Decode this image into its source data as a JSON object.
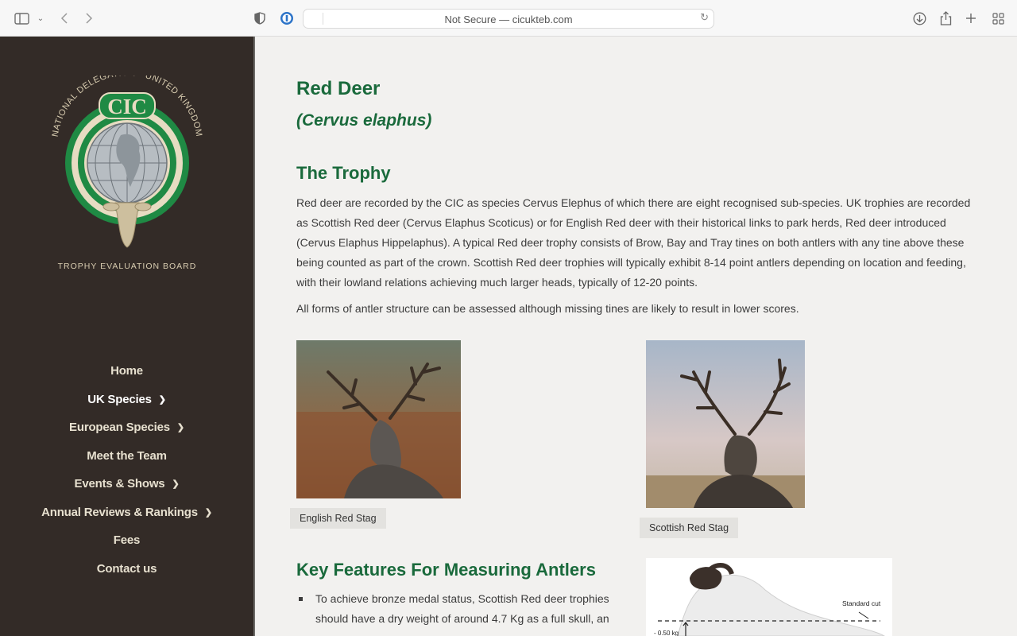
{
  "browser": {
    "address": "Not Secure — cicukteb.com",
    "icons": [
      "sidebar-icon",
      "chevron-down-icon",
      "back-icon",
      "forward-icon",
      "shield-icon",
      "password-icon",
      "reload-icon",
      "download-icon",
      "share-icon",
      "new-tab-icon",
      "tab-overview-icon"
    ]
  },
  "sidebar": {
    "logo_text_top": "NATIONAL DELEGATION · UNITED KINGDOM",
    "logo_text_cic": "CIC",
    "logo_text_bottom": "TROPHY EVALUATION BOARD",
    "nav": [
      {
        "label": "Home",
        "has_children": false
      },
      {
        "label": "UK Species",
        "has_children": true,
        "active": true
      },
      {
        "label": "European Species",
        "has_children": true
      },
      {
        "label": "Meet the Team",
        "has_children": false
      },
      {
        "label": "Events & Shows",
        "has_children": true
      },
      {
        "label": "Annual Reviews & Rankings",
        "has_children": true
      },
      {
        "label": "Fees",
        "has_children": false
      },
      {
        "label": "Contact us",
        "has_children": false
      }
    ]
  },
  "main": {
    "title": "Red Deer",
    "subtitle": "(Cervus elaphus)",
    "trophy_heading": "The Trophy",
    "trophy_para1": "Red deer are recorded by the CIC as species Cervus Elephus of which there are eight recognised sub-species. UK trophies are recorded as Scottish Red deer (Cervus Elaphus Scoticus) or for English Red deer with their historical links to park herds, Red deer introduced (Cervus Elaphus Hippelaphus). A typical Red deer trophy consists of Brow, Bay and Tray tines on both antlers with any tine above these being counted as part of the crown. Scottish Red deer trophies will typically exhibit 8-14 point antlers depending on location and feeding, with their lowland relations achieving much larger heads, typically of 12-20 points.",
    "trophy_para2": "All forms of antler structure can be assessed although missing tines are likely to result in lower scores.",
    "image1_caption": "English Red Stag",
    "image2_caption": "Scottish Red Stag",
    "features_heading": "Key Features For Measuring Antlers",
    "features": [
      "To achieve bronze medal status, Scottish Red deer trophies should have a dry weight of around 4.7 Kg as a full skull, an"
    ],
    "diagram_labels": {
      "standard_cut": "Standard cut",
      "weight": "- 0.50 kg"
    }
  }
}
